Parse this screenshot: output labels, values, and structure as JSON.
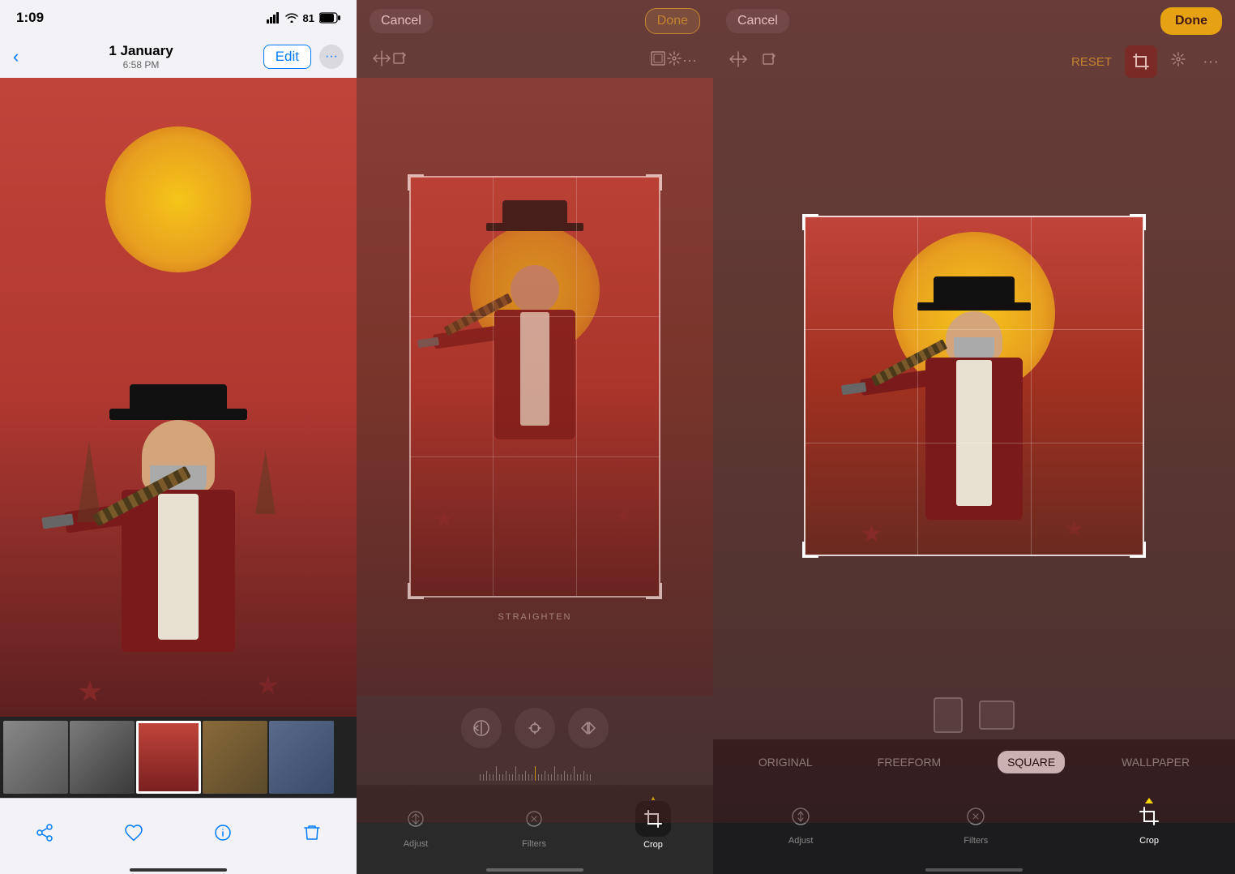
{
  "panel1": {
    "statusbar": {
      "time": "1:09",
      "signal": "signal",
      "wifi": "wifi",
      "battery": "81"
    },
    "navbar": {
      "title": "1 January",
      "subtitle": "6:58 PM",
      "edit_label": "Edit",
      "back_label": ""
    },
    "toolbar": {
      "share_label": "share",
      "like_label": "like",
      "info_label": "info",
      "delete_label": "delete"
    }
  },
  "panel2": {
    "header": {
      "cancel_label": "Cancel",
      "done_label": "Done"
    },
    "straighten_label": "STRAIGHTEN",
    "bottom_toolbar": {
      "adjust_label": "Adjust",
      "filters_label": "Filters",
      "crop_label": "Crop"
    }
  },
  "panel3": {
    "header": {
      "cancel_label": "Cancel",
      "done_label": "Done",
      "reset_label": "RESET"
    },
    "aspect_options": [
      "ORIGINAL",
      "FREEFORM",
      "SQUARE",
      "WALLPAPER"
    ],
    "active_aspect": "SQUARE",
    "bottom_toolbar": {
      "adjust_label": "Adjust",
      "filters_label": "Filters",
      "crop_label": "Crop"
    }
  }
}
